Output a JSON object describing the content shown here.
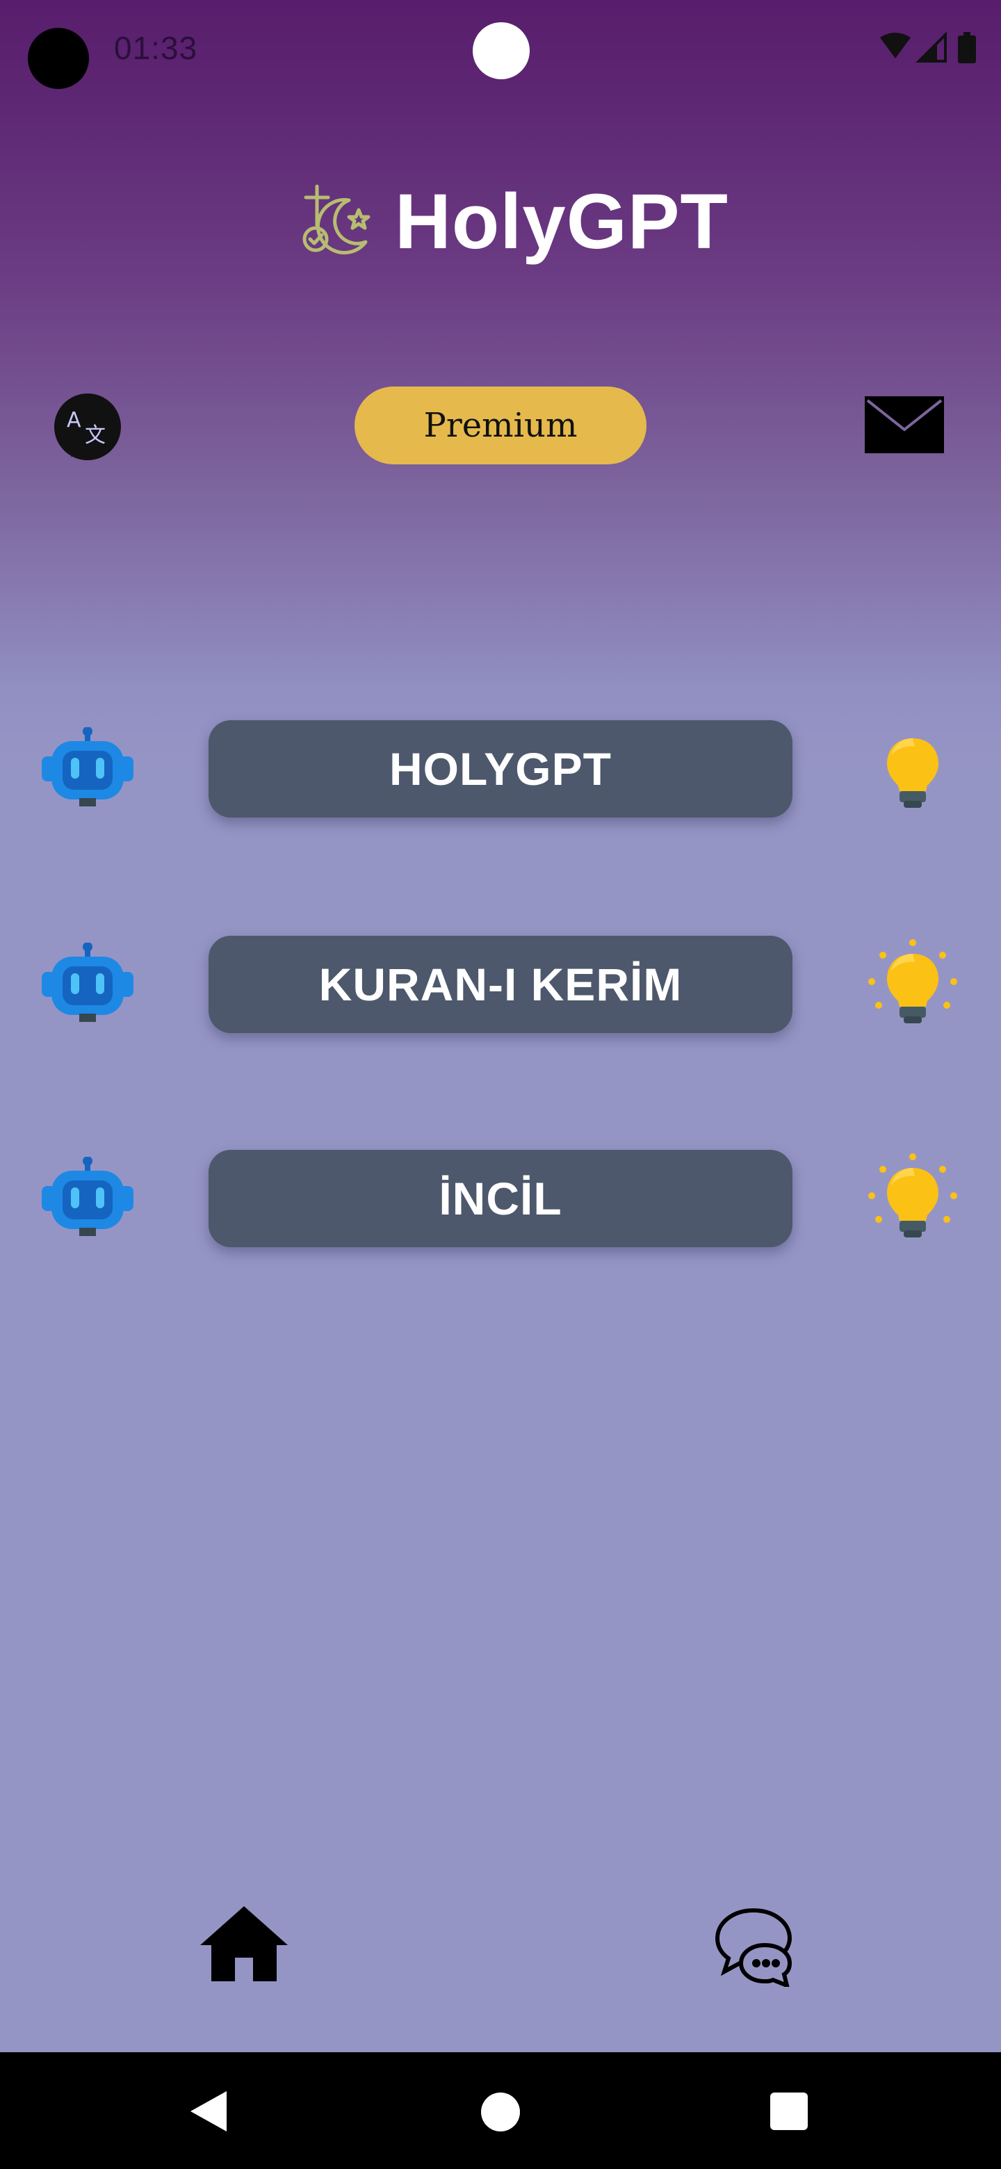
{
  "status_bar": {
    "time": "01:33",
    "icons": [
      "wifi-icon",
      "signal-icon",
      "battery-icon"
    ]
  },
  "header": {
    "title": "HolyGPT",
    "logo_icon": "religions-logo-icon"
  },
  "actions": {
    "translate_icon": "translate-icon",
    "premium_label": "Premium",
    "mail_icon": "mail-icon"
  },
  "menu": [
    {
      "label": "HOLYGPT",
      "left_icon": "robot-icon",
      "right_icon": "lightbulb-icon",
      "bulb_glowing": false
    },
    {
      "label": "KURAN-I KERİM",
      "left_icon": "robot-icon",
      "right_icon": "lightbulb-glowing-icon",
      "bulb_glowing": true
    },
    {
      "label": "İNCİL",
      "left_icon": "robot-icon",
      "right_icon": "lightbulb-glowing-icon",
      "bulb_glowing": true
    }
  ],
  "bottom_nav": {
    "items": [
      "home-icon",
      "chat-bubbles-icon"
    ]
  },
  "system_nav": {
    "items": [
      "back-icon",
      "home-circle-icon",
      "recents-square-icon"
    ]
  },
  "colors": {
    "gradient_top": "#581e6d",
    "gradient_bottom": "#9595c5",
    "premium": "#e5b94c",
    "menu_button": "#4d586c",
    "bulb": "#fbc114",
    "robot": "#1e88e5"
  }
}
